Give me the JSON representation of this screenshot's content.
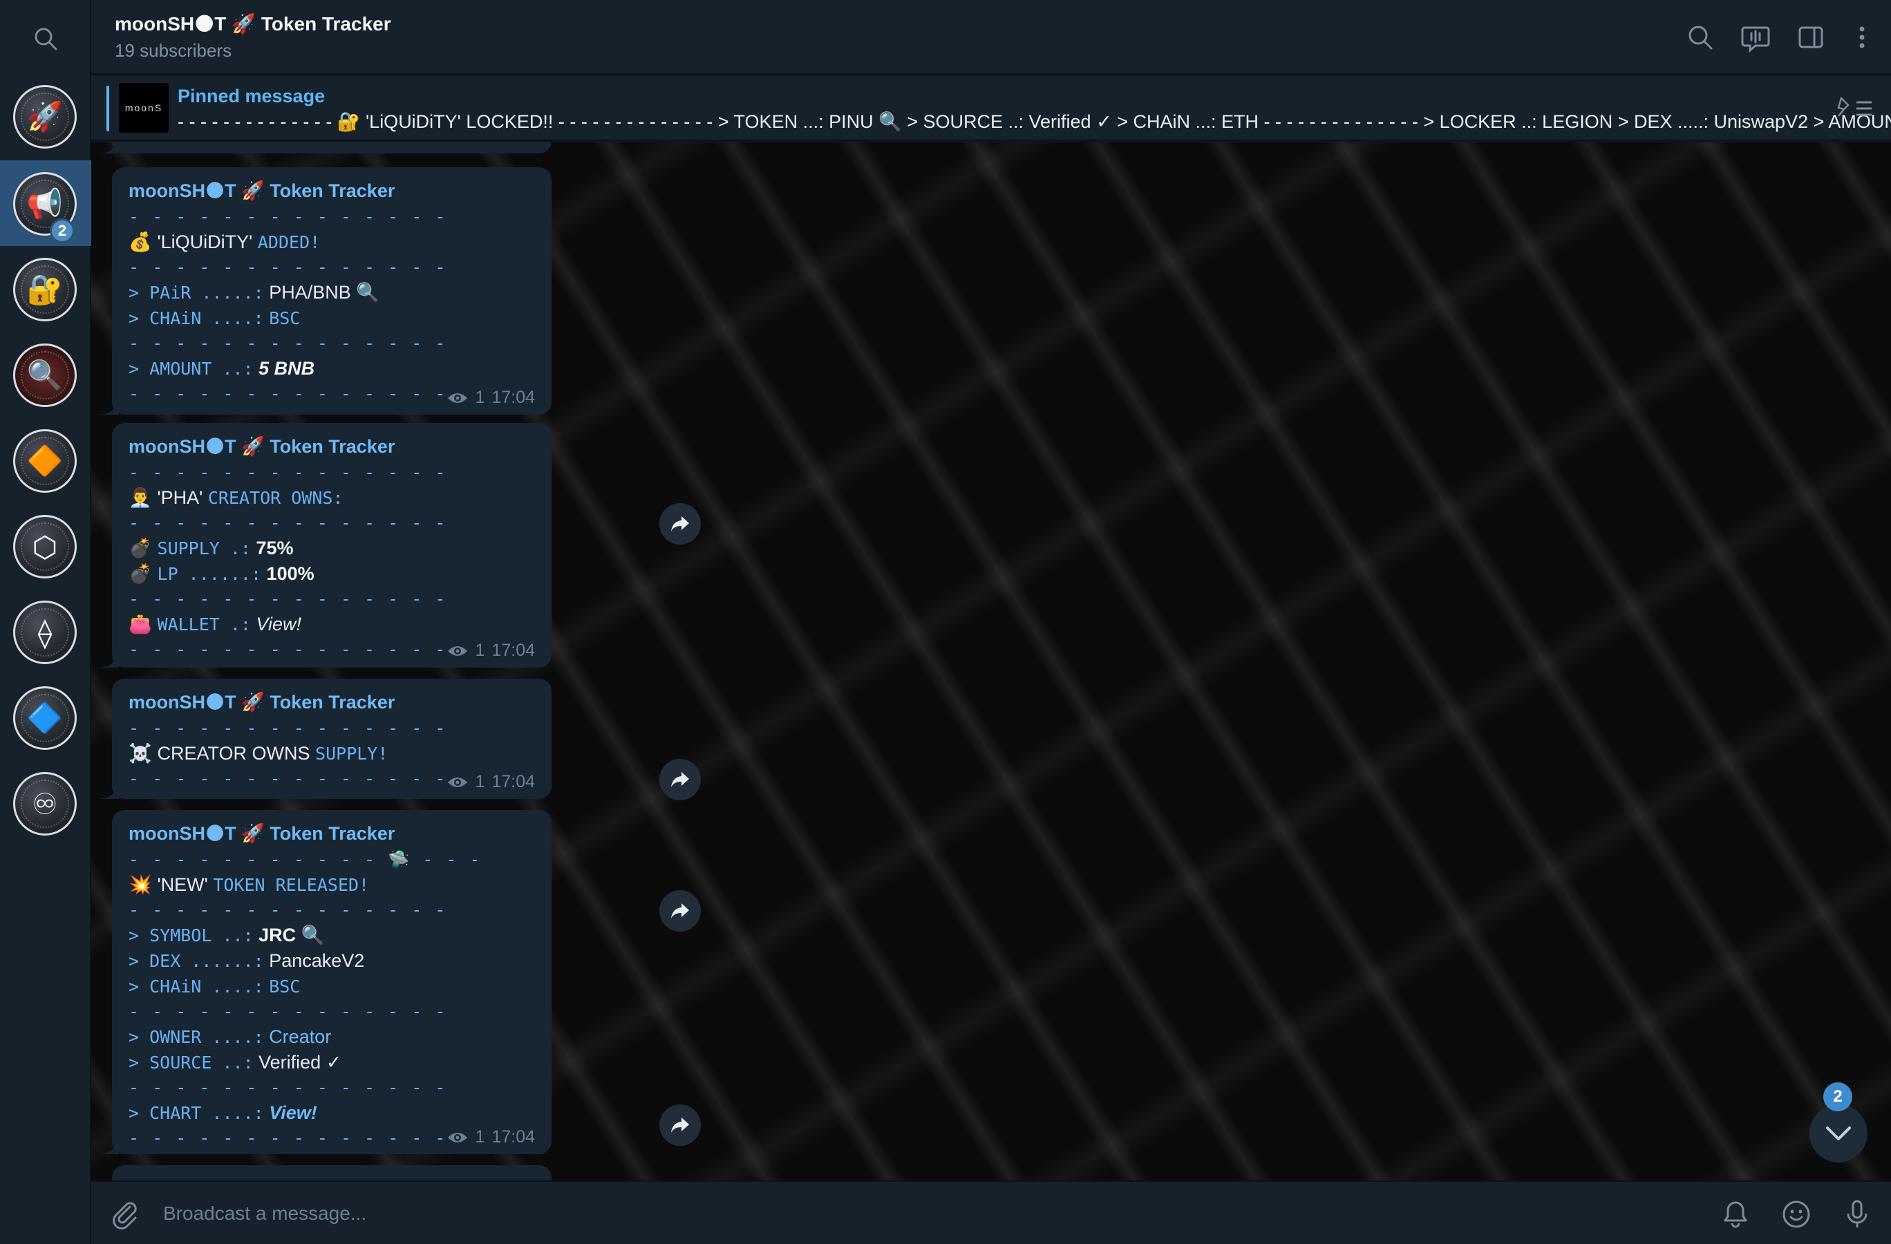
{
  "channel": {
    "title": "moonSH🌑T 🚀 Token Tracker",
    "subscribers": "19 subscribers"
  },
  "rail": {
    "folders": [
      {
        "name": "rocket",
        "glyph": "🚀",
        "badge": ""
      },
      {
        "name": "megaphone",
        "glyph": "📢",
        "badge": "2"
      },
      {
        "name": "lock",
        "glyph": "🔐",
        "badge": ""
      },
      {
        "name": "magnifier",
        "glyph": "🔍",
        "badge": ""
      },
      {
        "name": "bnb",
        "glyph": "🔶",
        "badge": ""
      },
      {
        "name": "hex",
        "glyph": "⬡",
        "badge": ""
      },
      {
        "name": "ethereum",
        "glyph": "⟠",
        "badge": ""
      },
      {
        "name": "base",
        "glyph": "🔷",
        "badge": ""
      },
      {
        "name": "infinity",
        "glyph": "♾",
        "badge": ""
      }
    ]
  },
  "pinned": {
    "label": "Pinned message",
    "thumb": "moonS",
    "text": "- - - - - - - - - - - - - - 🔐 'LiQUiDiTY' LOCKED!! - - - - - - - - - - - - - - > TOKEN ...: PINU 🔍 > SOURCE ..: Verified ✓ > CHAiN ...: ETH - - - - - - - - - - - - - - > LOCKER ..: LEGION > DEX .....: UniswapV2 > AMOUN..."
  },
  "dashes": "- - - - - - - - - - - - - -",
  "messages": {
    "m1": {
      "sender": "moonSH🌑T 🚀 Token Tracker",
      "head_emoji": "💰",
      "head_quote": "'LiQUiDiTY'",
      "head_word": "ADDED!",
      "pair_key": "> PAiR .....:",
      "pair_val": "PHA/BNB",
      "pair_icon": "🔍",
      "chain_key": "> CHAiN ....:",
      "chain_val": "BSC",
      "amount_key": "> AMOUNT ..:",
      "amount_val": "5 BNB",
      "views": "1",
      "time": "17:04"
    },
    "m2": {
      "sender": "moonSH🌑T 🚀 Token Tracker",
      "head_emoji": "👨‍💼",
      "head_quote": "'PHA'",
      "head_word": "CREATOR OWNS:",
      "supply_emoji": "💣",
      "supply_key": "SUPPLY .:",
      "supply_val": "75%",
      "lp_emoji": "💣",
      "lp_key": "LP ......:",
      "lp_val": "100%",
      "wallet_emoji": "👛",
      "wallet_key": "WALLET .:",
      "wallet_val": "View!",
      "views": "1",
      "time": "17:04"
    },
    "m3": {
      "sender": "moonSH🌑T 🚀 Token Tracker",
      "head_emoji": "☠️",
      "head_text": "CREATOR OWNS",
      "head_word": "SUPPLY!",
      "views": "1",
      "time": "17:04"
    },
    "m4": {
      "sender": "moonSH🌑T 🚀 Token Tracker",
      "dashes_ufo": "- - - - - - - - - - - 🛸 - - -",
      "head_emoji": "💥",
      "head_quote": "'NEW'",
      "head_word": "TOKEN RELEASED!",
      "symbol_key": "> SYMBOL ..:",
      "symbol_val": "JRC",
      "symbol_icon": "🔍",
      "dex_key": "> DEX ......:",
      "dex_val": "PancakeV2",
      "chain_key": "> CHAiN ....:",
      "chain_val": "BSC",
      "owner_key": "> OWNER ....:",
      "owner_val": "Creator",
      "source_key": "> SOURCE ..:",
      "source_val": "Verified ✓",
      "chart_key": "> CHART ....:",
      "chart_val": "View!",
      "views": "1",
      "time": "17:04"
    }
  },
  "scroll": {
    "badge": "2"
  },
  "composer": {
    "placeholder": "Broadcast a message..."
  },
  "colors": {
    "accent": "#5eb5f7",
    "bubble": "#182533",
    "sidebar": "#17212b",
    "active_folder": "#2b5278"
  }
}
